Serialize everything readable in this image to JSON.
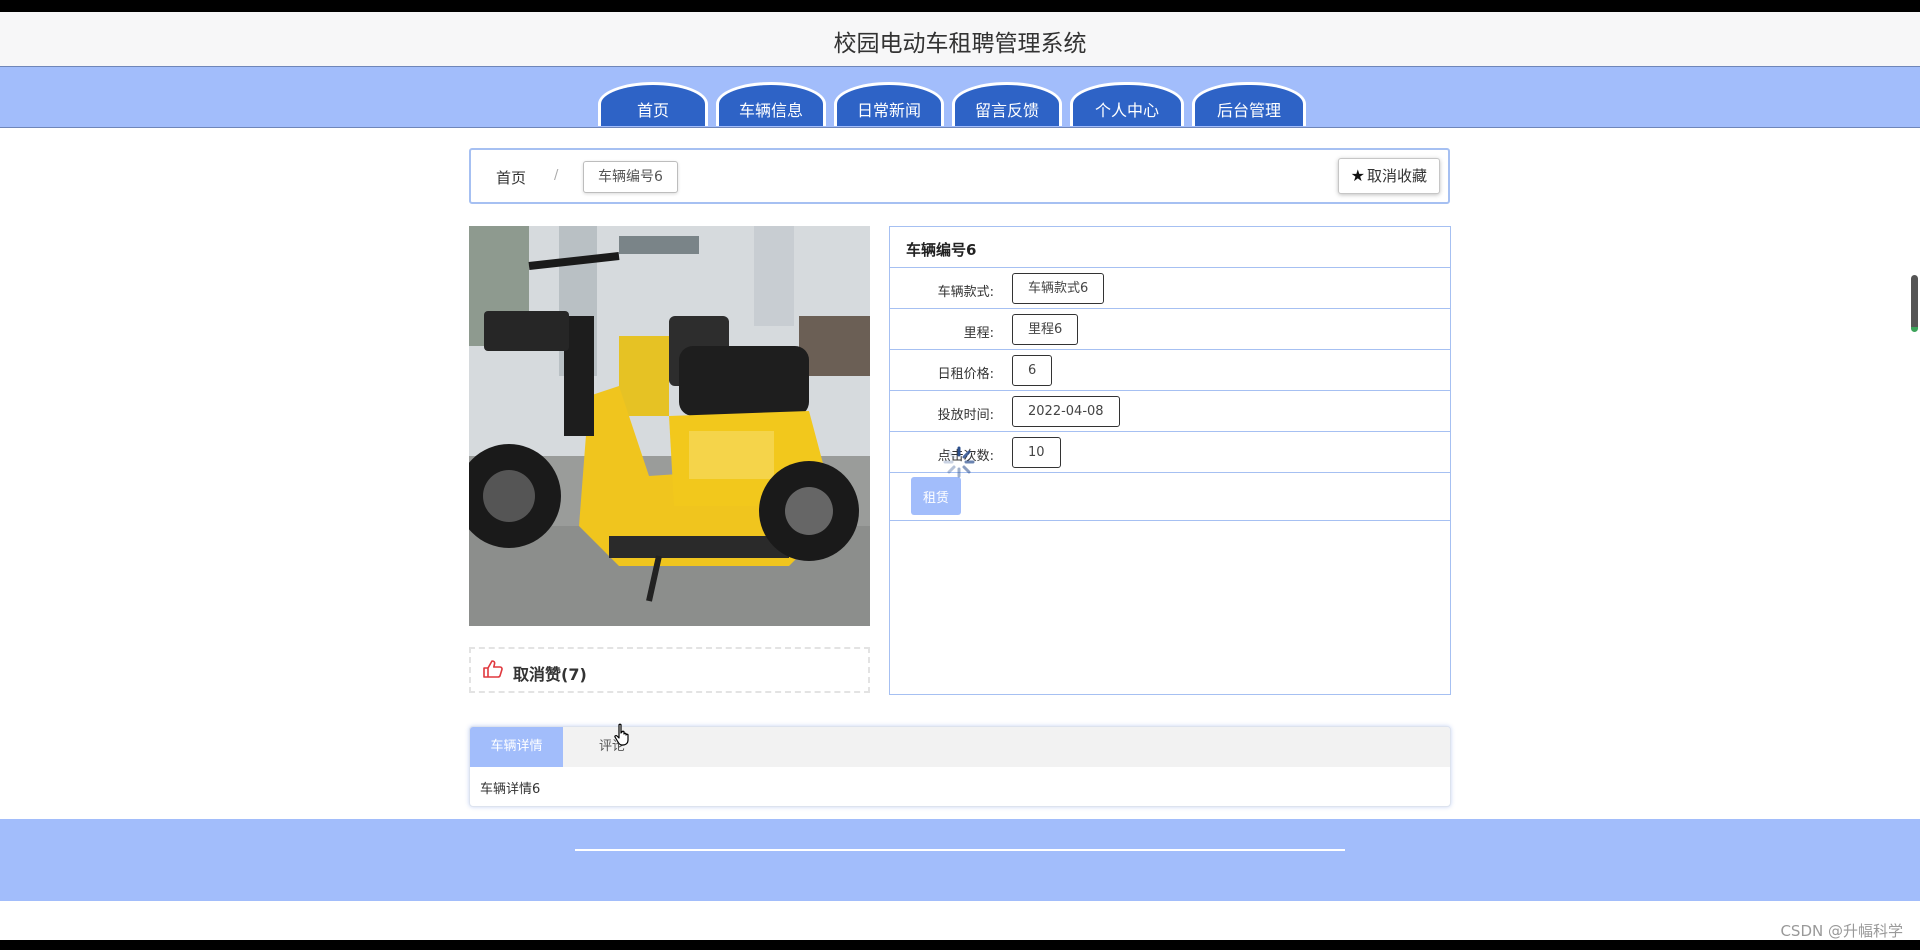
{
  "site": {
    "title": "校园电动车租聘管理系统"
  },
  "nav": {
    "items": [
      {
        "label": "首页"
      },
      {
        "label": "车辆信息"
      },
      {
        "label": "日常新闻"
      },
      {
        "label": "留言反馈"
      },
      {
        "label": "个人中心"
      },
      {
        "label": "后台管理"
      }
    ]
  },
  "breadcrumb": {
    "home": "首页",
    "separator": "/",
    "current": "车辆编号6",
    "favorite_button": "取消收藏",
    "favorite_icon": "star-icon"
  },
  "like": {
    "label": "取消赞(7)",
    "icon": "thumbs-up-icon"
  },
  "detail": {
    "title": "车辆编号6",
    "fields": [
      {
        "label": "车辆款式:",
        "value": "车辆款式6"
      },
      {
        "label": "里程:",
        "value": "里程6"
      },
      {
        "label": "日租价格:",
        "value": "6"
      },
      {
        "label": "投放时间:",
        "value": "2022-04-08"
      },
      {
        "label": "点击次数:",
        "value": "10"
      }
    ],
    "rent_button": "租赁"
  },
  "tabs": {
    "items": [
      {
        "label": "车辆详情"
      },
      {
        "label": "评论"
      }
    ],
    "active_content": "车辆详情6"
  },
  "watermark": "CSDN @升幅科学",
  "colors": {
    "nav_band": "#a2bdfb",
    "nav_tab": "#2e63c6",
    "border_accent": "#a6c0f2",
    "like_icon": "#e0383e"
  }
}
